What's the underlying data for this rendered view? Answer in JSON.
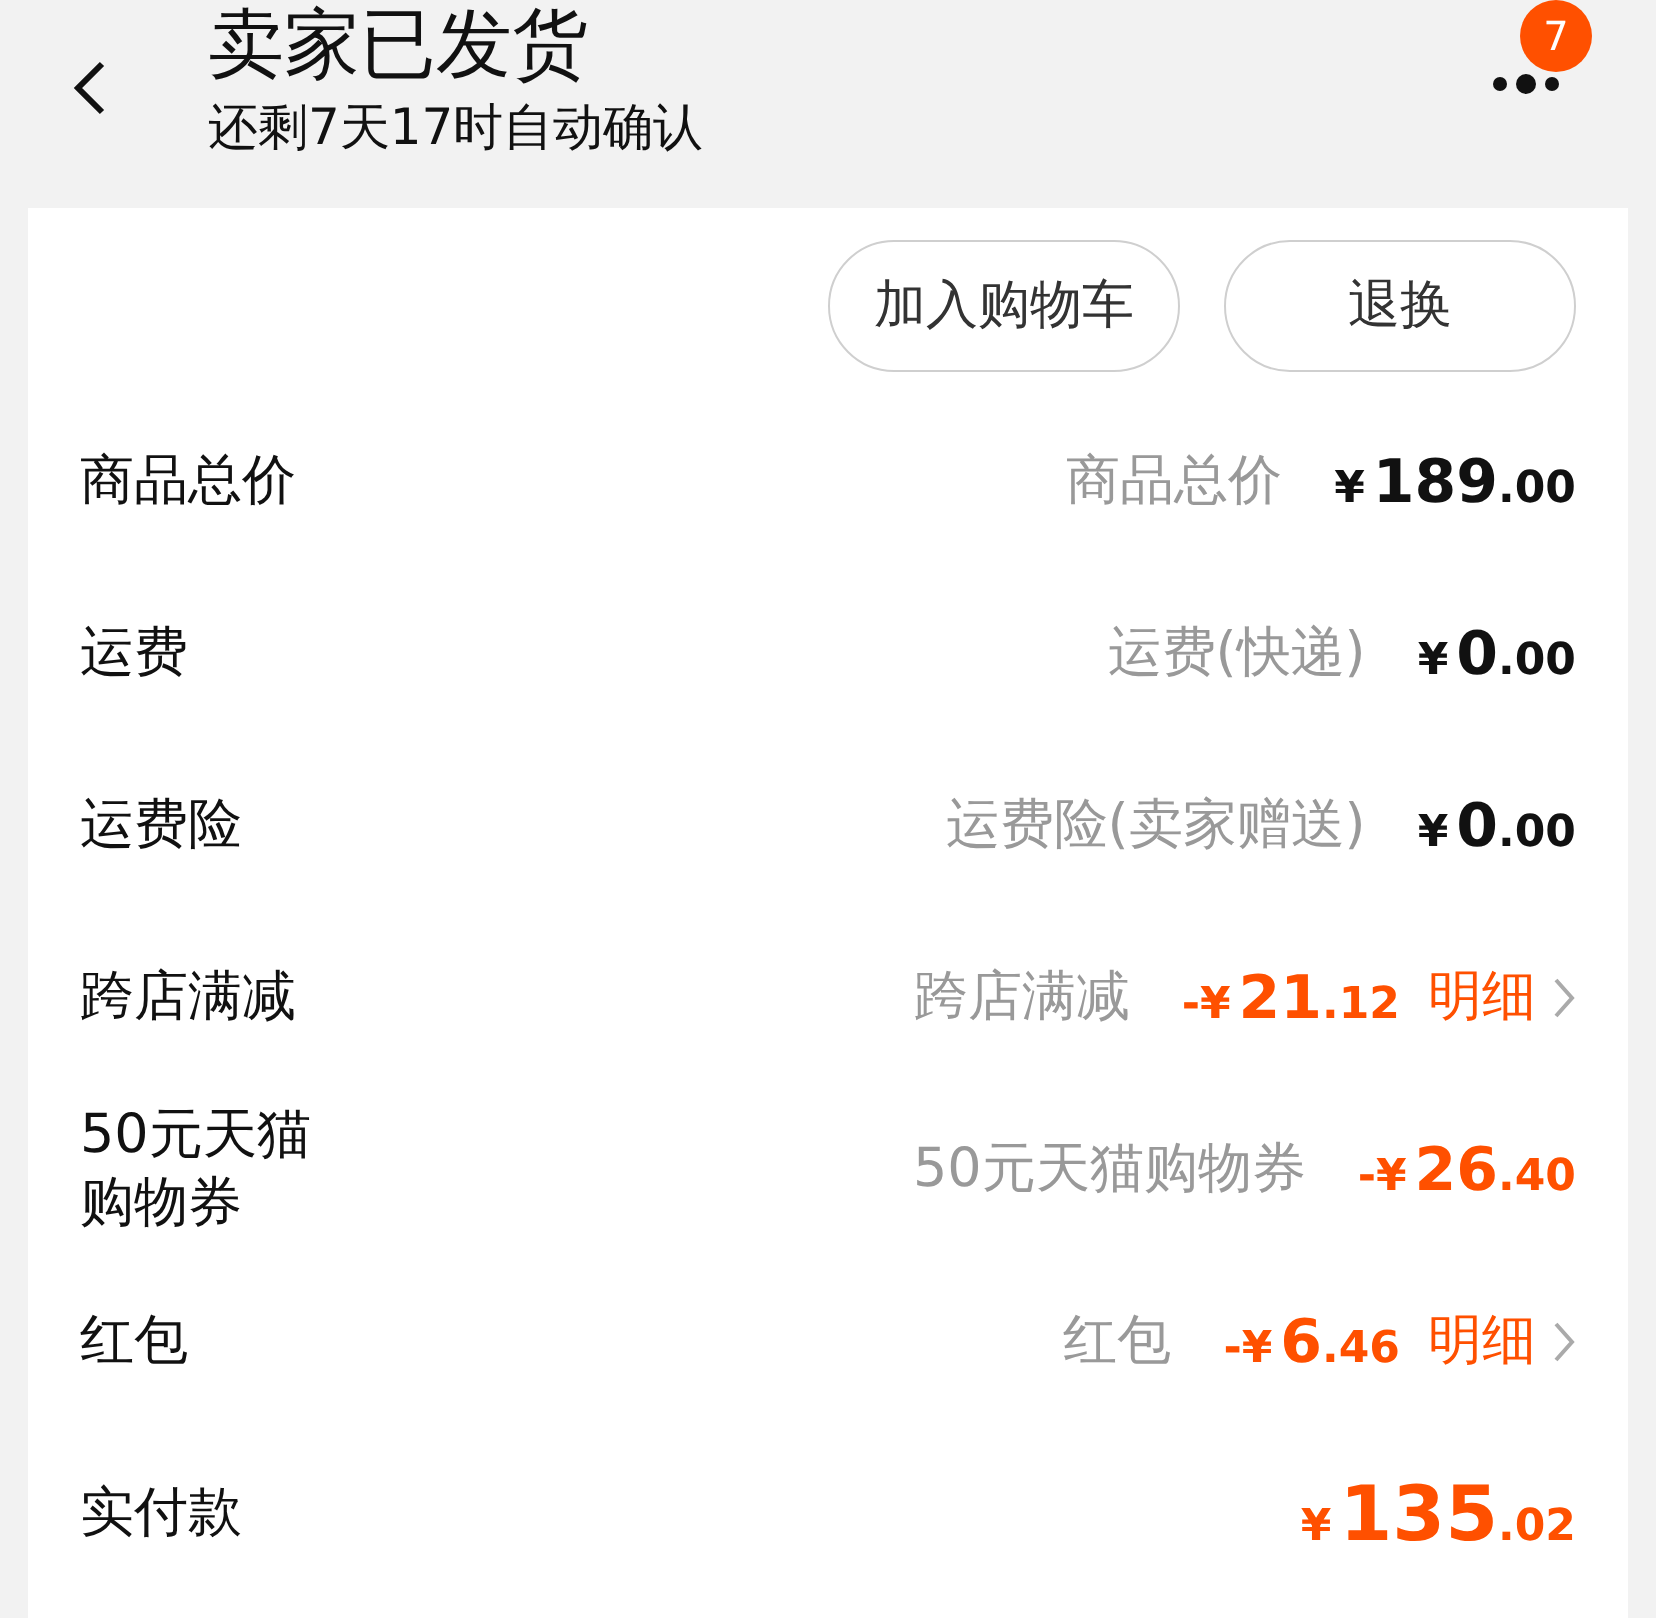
{
  "header": {
    "title": "卖家已发货",
    "subtitle": "还剩7天17时自动确认",
    "badge": "7"
  },
  "actions": [
    "加入购物车",
    "退换"
  ],
  "rows": [
    {
      "label": "商品总价",
      "desc": "商品总价",
      "amount": "¥189.00",
      "kind": "normal"
    },
    {
      "label": "运费",
      "desc": "运费(快递)",
      "amount": "¥0.00",
      "kind": "normal"
    },
    {
      "label": "运费险",
      "desc": "运费险(卖家赠送)",
      "amount": "¥0.00",
      "kind": "normal"
    },
    {
      "label": "跨店满减",
      "desc": "跨店满减",
      "amount": "-¥21.12",
      "kind": "discount",
      "detail": "明细"
    },
    {
      "label": "50元天猫购物券",
      "desc": "50元天猫购物券",
      "amount": "-¥26.40",
      "kind": "discount"
    },
    {
      "label": "红包",
      "desc": "红包",
      "amount": "-¥6.46",
      "kind": "discount",
      "detail": "明细"
    },
    {
      "label": "实付款",
      "amount": "¥135.02",
      "kind": "total"
    }
  ]
}
